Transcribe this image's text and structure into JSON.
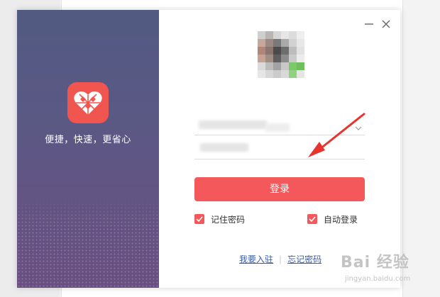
{
  "brand": {
    "slogan": "便捷，快速，更省心",
    "logo_icon": "pinduoduo-heart-logo",
    "accent_color": "#f4585a",
    "panel_color": "#5b5884"
  },
  "window": {
    "minimize_icon": "minimize-icon",
    "close_icon": "close-icon"
  },
  "form": {
    "username_value": "",
    "password_value": "",
    "login_label": "登录",
    "remember_label": "记住密码",
    "remember_checked": true,
    "auto_login_label": "自动登录",
    "auto_login_checked": true
  },
  "links": {
    "join_label": "我要入驻",
    "forgot_label": "忘记密码"
  },
  "watermark": {
    "main": "Bai 经验",
    "sub": "jingyan.baidu.com"
  }
}
